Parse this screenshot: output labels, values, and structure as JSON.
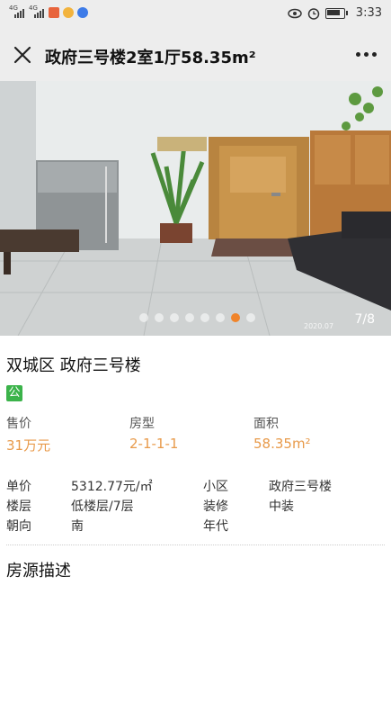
{
  "status_bar": {
    "time": "3:33",
    "network_1": "4G",
    "network_2": "4G",
    "icons": [
      "signal-icon",
      "signal-icon",
      "app-icon",
      "app-icon",
      "app-icon",
      "eye-icon",
      "alarm-icon",
      "battery-icon"
    ]
  },
  "nav": {
    "title": "政府三号楼2室1厅58.35m²",
    "close_icon": "close-icon",
    "more_icon": "more-icon"
  },
  "gallery": {
    "counter": "7/8",
    "total": 8,
    "active_index": 7,
    "timestamp": "2020.07"
  },
  "listing": {
    "location": "双城区 政府三号楼",
    "tag": "公",
    "tag_color": "#3bb34a",
    "price_label": "售价",
    "price_value": "31万元",
    "layout_label": "房型",
    "layout_value": "2-1-1-1",
    "area_label": "面积",
    "area_value": "58.35m²",
    "accent_color": "#e89a4a"
  },
  "details": [
    {
      "label": "单价",
      "value": "5312.77元/㎡",
      "label2": "小区",
      "value2": "政府三号楼"
    },
    {
      "label": "楼层",
      "value": "低楼层/7层",
      "label2": "装修",
      "value2": "中装"
    },
    {
      "label": "朝向",
      "value": "南",
      "label2": "年代",
      "value2": ""
    }
  ],
  "section": {
    "description_title": "房源描述"
  }
}
